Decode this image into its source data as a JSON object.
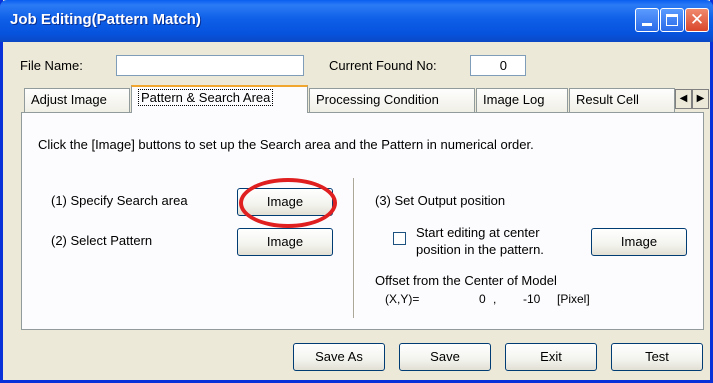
{
  "window": {
    "title": "Job Editing(Pattern Match)"
  },
  "header": {
    "file_name_label": "File Name:",
    "file_name_value": "",
    "current_found_label": "Current Found No:",
    "current_found_value": "0"
  },
  "tabs": [
    {
      "label": "Adjust Image"
    },
    {
      "label": "Pattern & Search Area"
    },
    {
      "label": "Processing Condition"
    },
    {
      "label": "Image Log"
    },
    {
      "label": "Result Cell"
    }
  ],
  "panel": {
    "instruction": "Click the [Image] buttons to set up the Search area and the Pattern in numerical order.",
    "step1_label": "(1) Specify Search area",
    "step2_label": "(2) Select Pattern",
    "step3_label": "(3) Set Output position",
    "checkbox_line1": "Start editing at center",
    "checkbox_line2": "position in the pattern.",
    "offset_title": "Offset from the Center of Model",
    "offset_prefix": "(X,Y)=",
    "offset_x": "0",
    "offset_sep": ",",
    "offset_y": "-10",
    "offset_unit": "[Pixel]",
    "image_button_label": "Image"
  },
  "footer": {
    "save_as": "Save As",
    "save": "Save",
    "exit": "Exit",
    "test": "Test"
  },
  "colors": {
    "title_bar": "#0a5ef0",
    "highlight_circle": "#e02020",
    "active_tab_accent": "#f1a630"
  }
}
